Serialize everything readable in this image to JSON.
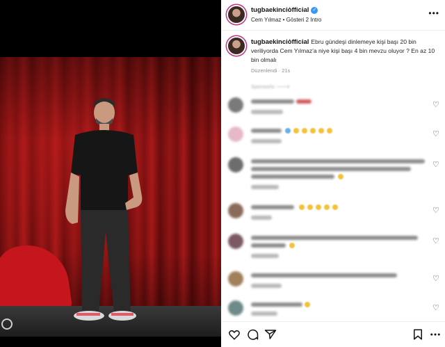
{
  "post": {
    "username": "tugbaekinciȯfficial",
    "subtitle": "Cem Yılmaz • Gösteri 2 Intro",
    "caption_text": "Ebru gündeşi dinlemeye kişi başı 20 bin veriliyorda Cem Yılmaz'a niye kişi başı 4 bin mevzu oluyor ? En az 10 bin olmalı",
    "caption_meta": "Düzenlendi · 21s"
  },
  "comments_header": "Sponsorlu 🡒",
  "icons": {
    "verified": "verified-badge-icon",
    "more": "more-options-icon",
    "heart": "heart-icon",
    "comment": "comment-icon",
    "share": "share-icon",
    "save": "bookmark-icon",
    "media": "play-circle-icon"
  },
  "colors": {
    "accent": "#3897f0",
    "story_ring": "#c13584",
    "curtain": "#8e1414"
  }
}
